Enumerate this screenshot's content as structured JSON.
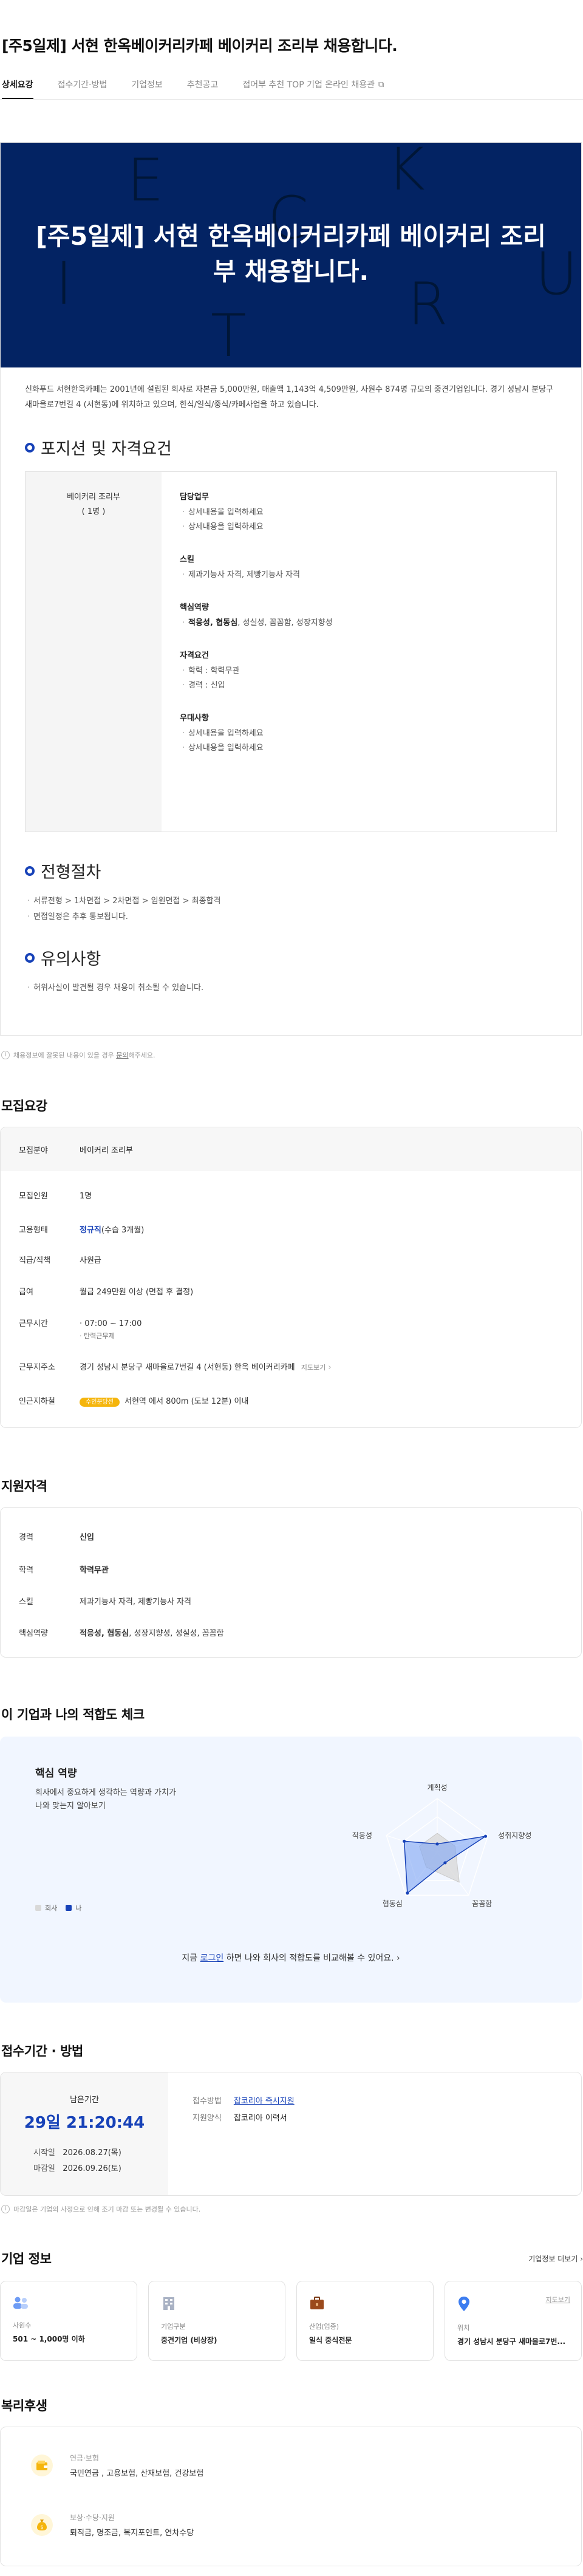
{
  "page_title": "[주5일제] 서현 한옥베이커리카페 베이커리 조리부 채용합니다.",
  "tabs": [
    {
      "label": "상세요강",
      "active": true
    },
    {
      "label": "접수기간·방법",
      "active": false
    },
    {
      "label": "기업정보",
      "active": false
    },
    {
      "label": "추천공고",
      "active": false
    },
    {
      "label": "접어부 추천 TOP 기업 온라인 채용관",
      "active": false,
      "external_icon": "external-link-icon"
    }
  ],
  "banner": {
    "title": "[주5일제] 서현 한옥베이커리카페 베이커리 조리부 채용합니다.",
    "bg_letters": [
      "E",
      "K",
      "C",
      "R",
      "U",
      "T",
      "I"
    ],
    "bg_color": "#032363"
  },
  "intro": "신화푸드 서현한옥카페는 2001년에 설립된 회사로 자본금 5,000만원, 매출액 1,143억 4,509만원, 사원수 874명 규모의 중견기업입니다. 경기 성남시 분당구 새마을로7번길 4 (서현동)에 위치하고 있으며, 한식/일식/중식/카페사업을 하고 있습니다.",
  "position_section": {
    "heading": "포지션 및 자격요건",
    "role": "베이커리 조리부",
    "headcount": "( 1명 )",
    "groups": [
      {
        "title": "담당업무",
        "items": [
          "상세내용을 입력하세요",
          "상세내용을 입력하세요"
        ]
      },
      {
        "title": "스킬",
        "items": [
          "제과기능사 자격, 제빵기능사 자격"
        ]
      },
      {
        "title": "핵심역량",
        "strong": "적응성, 협동심",
        "rest": ", 성실성, 꼼꼼함, 성장지향성"
      },
      {
        "title": "자격요건",
        "items": [
          "학력 : 학력무관",
          "경력 : 신입"
        ]
      },
      {
        "title": "우대사항",
        "items": [
          "상세내용을 입력하세요",
          "상세내용을 입력하세요"
        ]
      }
    ]
  },
  "process_section": {
    "heading": "전형절차",
    "items": [
      "서류전형 > 1차면접 > 2차면접 > 임원면접 > 최종합격",
      "면접일정은 추후 통보됩니다."
    ]
  },
  "caution_section": {
    "heading": "유의사항",
    "items": [
      "허위사실이 발견될 경우 채용이 취소될 수 있습니다."
    ]
  },
  "detail_note": {
    "text": "채용정보에 잘못된 내용이 있을 경우 ",
    "link": "문의",
    "suffix": "해주세요."
  },
  "recruit": {
    "heading": "모집요강",
    "rows": [
      {
        "k": "모집분야",
        "v": "베이커리 조리부"
      },
      {
        "k": "모집인원",
        "v": "1명"
      },
      {
        "k": "고용형태",
        "v_blue": "정규직",
        "v": "(수습 3개월)"
      },
      {
        "k": "직급/직책",
        "v": "사원급"
      },
      {
        "k": "급여",
        "v": "월급 249만원 이상 (면접 후 결정)"
      },
      {
        "k": "근무시간",
        "v": "07:00 ~ 17:00",
        "v2": "탄력근무제"
      },
      {
        "k": "근무지주소",
        "v": "경기 성남시 분당구 새마을로7번길 4 (서현동) 한옥 베이커리카페",
        "link": "지도보기"
      },
      {
        "k": "인근지하철",
        "badge": "수인분당선",
        "v": "서현역 에서 800m (도보 12분) 이내"
      }
    ]
  },
  "qualification": {
    "heading": "지원자격",
    "rows": [
      {
        "k": "경력",
        "v": "신입",
        "blue": true
      },
      {
        "k": "학력",
        "v": "학력무관",
        "blue": true
      },
      {
        "k": "스킬",
        "v": "제과기능사 자격, 제빵기능사 자격"
      },
      {
        "k": "핵심역량",
        "v_strong": "적응성, 협동심",
        "v": ", 성장지향성, 성실성, 꼼꼼함"
      }
    ]
  },
  "fit": {
    "heading": "이 기업과 나의 적합도 체크",
    "card_title": "핵심 역량",
    "desc1": "회사에서 중요하게 생각하는 역량과 가치가",
    "desc2": "나와 맞는지 알아보기",
    "legend_company": "회사",
    "legend_me": "나",
    "axes": [
      "계획성",
      "성취지향성",
      "꼼꼼함",
      "협동심",
      "적응성"
    ],
    "company_values": [
      0.35,
      0.35,
      0.7,
      0.35,
      0.35
    ],
    "me_values": [
      0.15,
      0.95,
      0.25,
      0.95,
      0.65
    ],
    "cta_pre": "지금 ",
    "cta_link": "로그인",
    "cta_post": " 하면 나와 회사의 적합도를 비교해볼 수 있어요.",
    "company_color": "#d9d9d9",
    "me_color": "#1742b8"
  },
  "apply": {
    "heading": "접수기간 · 방법",
    "remain_label": "남은기간",
    "remain_value": "29일 21:20:44",
    "start_label": "시작일",
    "start_value": "2026.08.27(목)",
    "end_label": "마감일",
    "end_value": "2026.09.26(토)",
    "method_label": "접수방법",
    "method_value": "잡코리아 즉시지원",
    "form_label": "지원양식",
    "form_value": "잡코리아 이력서",
    "note": "마감일은 기업의 사정으로 인해 조기 마감 또는 변경될 수 있습니다."
  },
  "company": {
    "heading": "기업 정보",
    "more": "기업정보 더보기",
    "cards": [
      {
        "label": "사원수",
        "value": "501 ~ 1,000명 이하",
        "icon": "people-icon"
      },
      {
        "label": "기업구분",
        "value": "중견기업 (비상장)",
        "icon": "building-icon"
      },
      {
        "label": "산업(업종)",
        "value": "일식 중식전문",
        "icon": "briefcase-icon"
      },
      {
        "label": "위치",
        "value": "경기 성남시 분당구 새마을로7번...",
        "icon": "location-pin-icon",
        "link": "지도보기"
      }
    ]
  },
  "welfare": {
    "heading": "복리후생",
    "rows": [
      {
        "category": "연금·보험",
        "items": "국민연금 , 고용보험, 산재보험, 건강보험",
        "icon": "wallet-icon"
      },
      {
        "category": "보상·수당·지원",
        "items": "퇴직금, 명조금, 복지포인트, 연차수당",
        "icon": "money-bag-icon"
      }
    ]
  }
}
